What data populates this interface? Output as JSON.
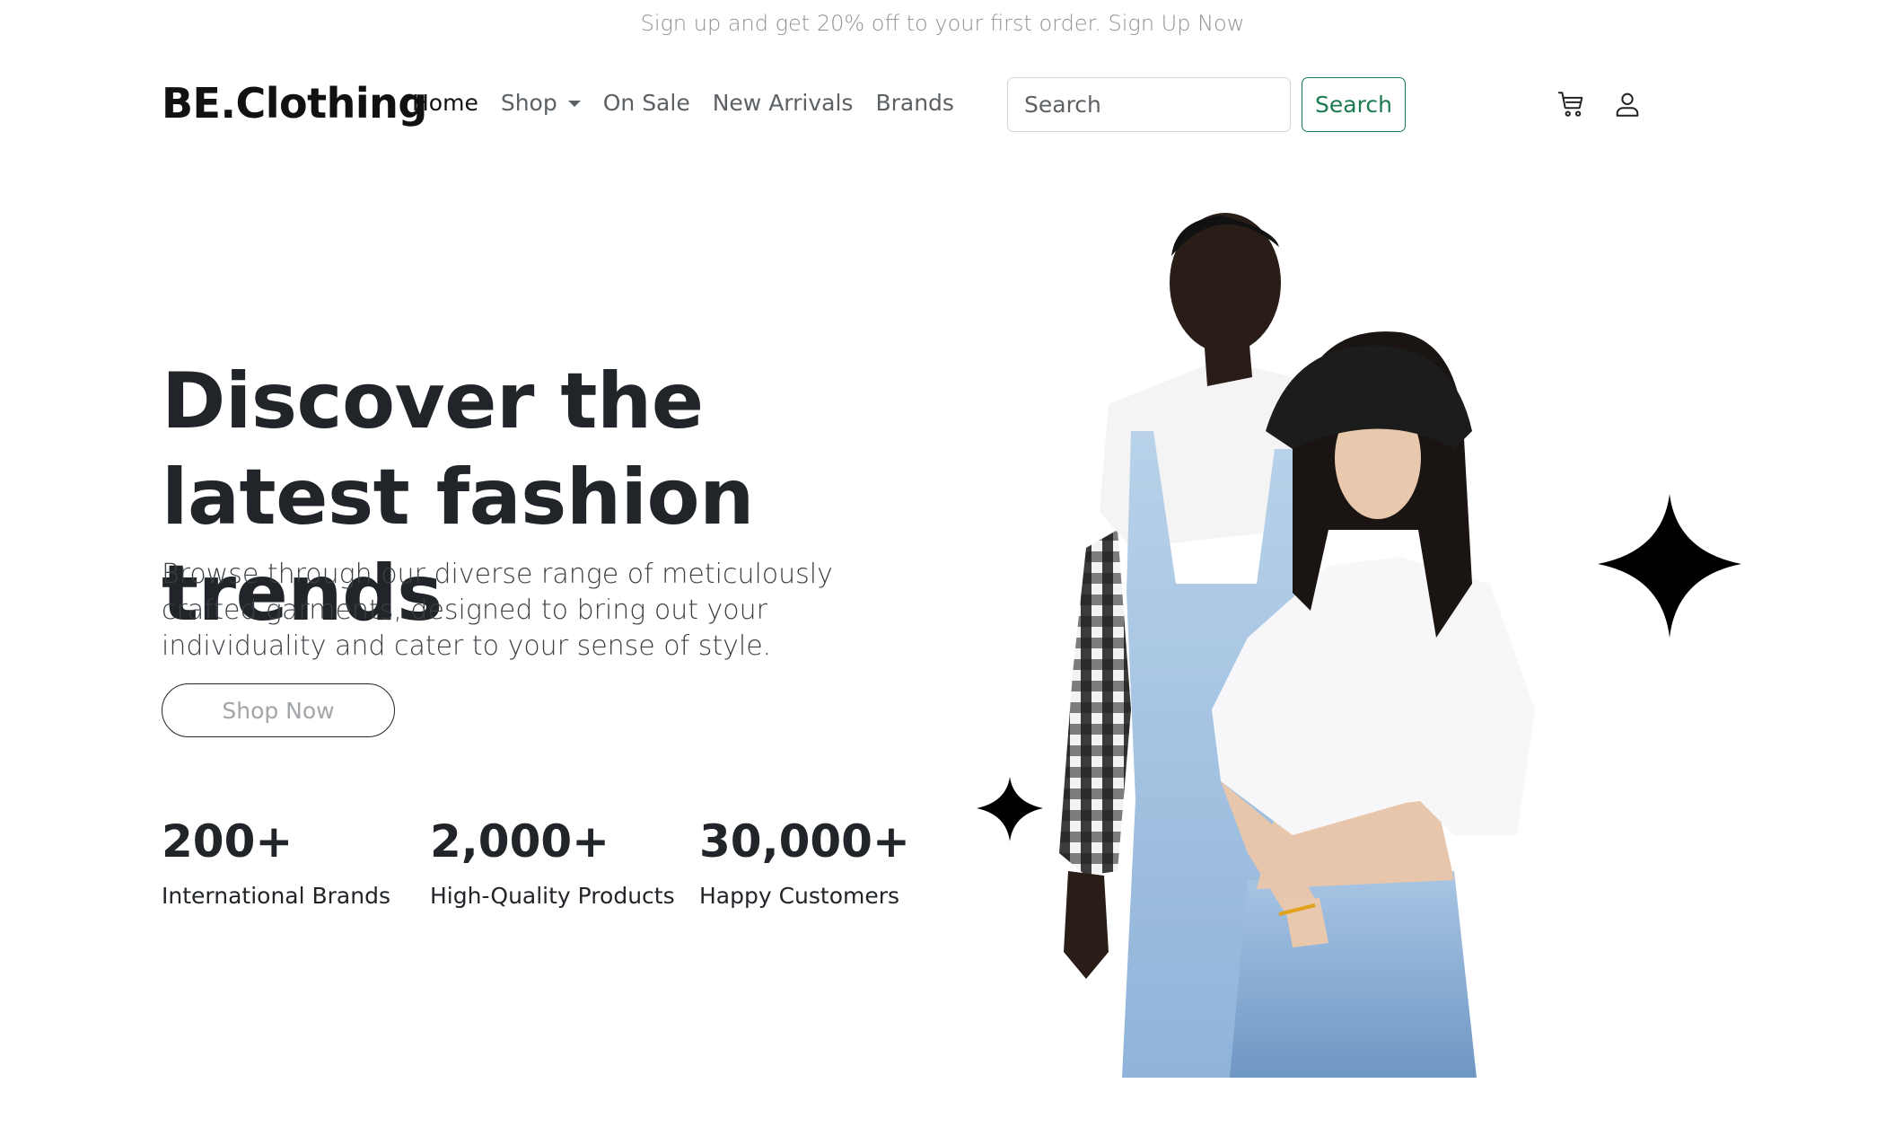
{
  "promo": {
    "text": "Sign up and get 20% off to your first order. Sign Up Now"
  },
  "navbar": {
    "brand": "BE.Clothing",
    "links": [
      {
        "label": "Home",
        "active": true
      },
      {
        "label": "Shop",
        "has_dropdown": true
      },
      {
        "label": "On Sale"
      },
      {
        "label": "New Arrivals"
      },
      {
        "label": "Brands"
      }
    ],
    "search": {
      "placeholder": "Search",
      "button_label": "Search"
    },
    "icons": [
      "cart-icon",
      "user-icon"
    ]
  },
  "hero": {
    "title": "Discover the latest fashion trends",
    "description": "Browse through our diverse range of meticulously crafted garments, designed to bring out your individuality and cater to your sense of style.",
    "cta_label": "Shop Now",
    "stats": [
      {
        "value": "200+",
        "label": "International Brands"
      },
      {
        "value": "2,000+",
        "label": "High-Quality Products"
      },
      {
        "value": "30,000+",
        "label": "Happy Customers"
      }
    ]
  },
  "colors": {
    "accent": "#1b7a4e",
    "text_dark": "#212529",
    "text_muted": "#5c6166"
  }
}
